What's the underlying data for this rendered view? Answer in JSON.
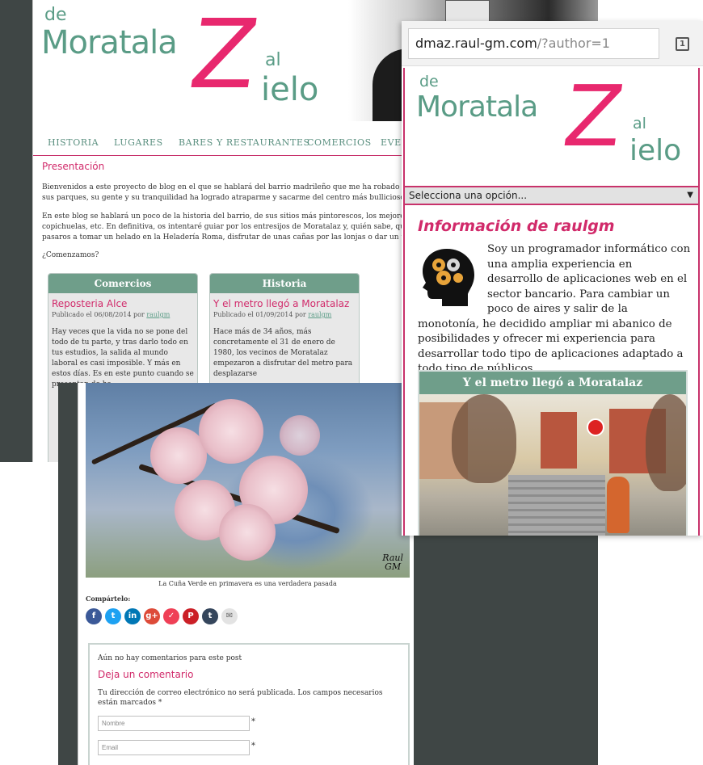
{
  "desktop": {
    "logo": {
      "de": "de",
      "name": "Moratala",
      "z": "Z",
      "al": "al",
      "ielo": "ielo"
    },
    "nav": [
      "HISTORIA",
      "LUGARES",
      "BARES Y RESTAURANTES",
      "COMERCIOS",
      "EVEN"
    ],
    "intro_title": "Presentación",
    "paragraphs": [
      "Bienvenidos a este proyecto de blog en el que se hablará del barrio madrileño que me ha robado el",
      "sus parques, su gente y su tranquilidad ha logrado atraparme y sacarme del centro más bullicioso d",
      "En este blog se hablará un poco de la historia del barrio, de sus sitios más pintorescos, los mejores",
      "copichuelas, etc. En definitiva, os intentaré guiar por los entresijos de Moratalaz y, quién sabe, quiz",
      "pasaros a tomar un helado en la Heladería Roma, disfrutar de unas cañas por las lonjas o dar un tra",
      "¿Comenzamos?"
    ],
    "cards": [
      {
        "category": "Comercios",
        "title": "Reposteria Alce",
        "meta_prefix": "Publicado el 06/08/2014 por",
        "author": "raulgm",
        "text": "Hay veces que la vida no se pone del todo de tu parte, y tras darlo todo en tus estudios, la salida al mundo laboral es casi imposible. Y más en estos días. Es en este punto cuando se presentan do ha"
      },
      {
        "category": "Historia",
        "title": "Y el metro llegó a Moratalaz",
        "meta_prefix": "Publicado el 01/09/2014 por",
        "author": "raulgm",
        "text": "Hace más de 34 años, más concretamente el 31 de enero de 1980, los vecinos de Moratalaz empezaron a disfrutar del metro para desplazarse"
      }
    ]
  },
  "post": {
    "signature_line1": "Raul",
    "signature_line2": "GM",
    "caption": "La Cuña Verde en primavera es una verdadera pasada",
    "share_label": "Compártelo:",
    "share_buttons": [
      {
        "name": "facebook-share-button",
        "glyph": "f",
        "color": "#3b5998"
      },
      {
        "name": "twitter-share-button",
        "glyph": "t",
        "color": "#1da1f2"
      },
      {
        "name": "linkedin-share-button",
        "glyph": "in",
        "color": "#0077b5"
      },
      {
        "name": "googleplus-share-button",
        "glyph": "g+",
        "color": "#dd4b39"
      },
      {
        "name": "pocket-share-button",
        "glyph": "✓",
        "color": "#ef4056"
      },
      {
        "name": "pinterest-share-button",
        "glyph": "P",
        "color": "#cb2027"
      },
      {
        "name": "tumblr-share-button",
        "glyph": "t",
        "color": "#35465c"
      },
      {
        "name": "email-share-button",
        "glyph": "✉",
        "color": "#e3e3e3"
      }
    ],
    "no_comments": "Aún no hay comentarios para este post",
    "leave_title": "Deja un comentario",
    "notice": "Tu dirección de correo electrónico no será publicada. Los campos necesarios están marcados *",
    "name_placeholder": "Nombre",
    "email_placeholder": "Email",
    "required_mark": "*"
  },
  "mobile": {
    "url_host": "dmaz.raul-gm.com",
    "url_rest": "/?author=1",
    "tab_count": "1",
    "select_label": "Selecciona una opción...",
    "select_caret": "▼",
    "info_title": "Información de raulgm",
    "bio": "Soy un programador informático con una amplia experiencia en desarrollo de aplicaciones web en el sector bancario. Para cambiar un poco de aires y salir de la monotonía, he decidido ampliar mi abanico de posibilidades y ofrecer mi experiencia para desarrollar todo tipo de aplicaciones adaptado a todo tipo de públicos.",
    "post_title": "Y el metro llegó a Moratalaz"
  },
  "colors": {
    "pink": "#d12a6a",
    "green": "#5a9c86",
    "card_header": "#6f9e8a",
    "dark_bg": "#3f4645"
  }
}
